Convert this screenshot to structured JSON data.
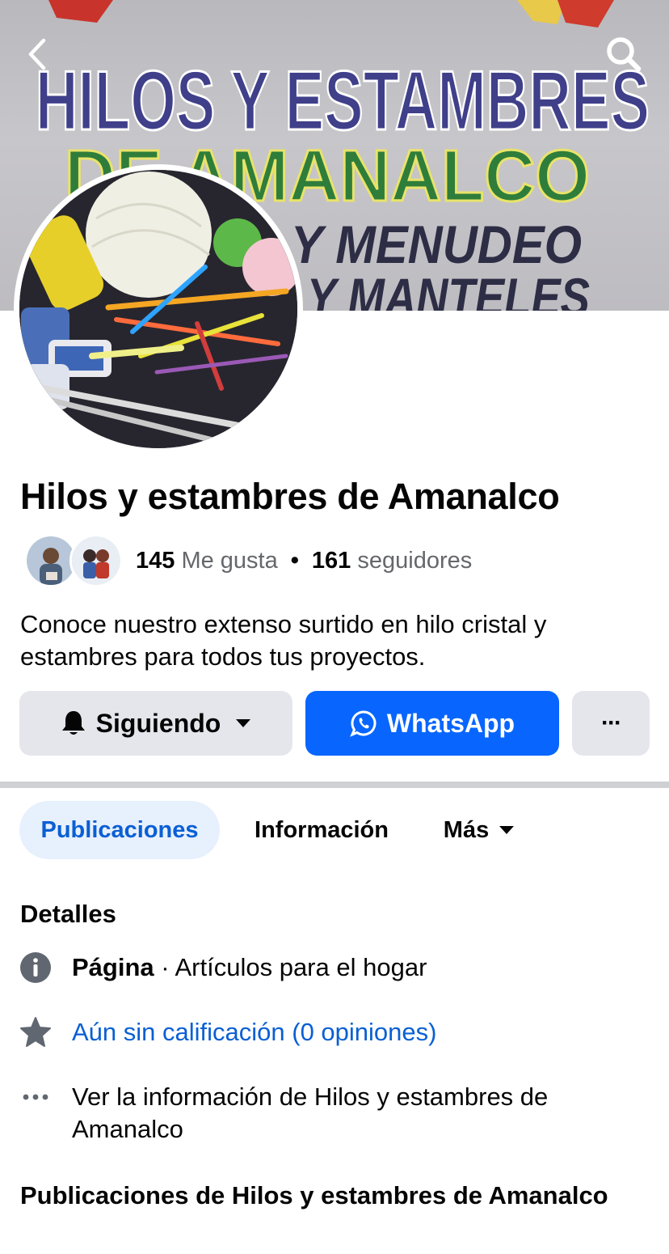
{
  "cover": {
    "sign_line1": "HILOS Y ESTAMBRES",
    "sign_line2": "DE AMANALCO",
    "sign_line3": "Y MENUDEO",
    "sign_line4": "Y MANTELES"
  },
  "nav": {
    "back_icon": "chevron-left-icon",
    "search_icon": "search-icon"
  },
  "page": {
    "title": "Hilos y estambres de Amanalco",
    "likes_count": "145",
    "likes_label": "Me gusta",
    "separator": "•",
    "followers_count": "161",
    "followers_label": "seguidores",
    "bio": "Conoce nuestro extenso surtido en hilo cristal y estambres para todos tus proyectos."
  },
  "actions": {
    "following_label": "Siguiendo",
    "whatsapp_label": "WhatsApp",
    "more_label": "···"
  },
  "tabs": [
    {
      "label": "Publicaciones",
      "active": true
    },
    {
      "label": "Información",
      "active": false
    },
    {
      "label": "Más",
      "active": false
    }
  ],
  "details": {
    "title": "Detalles",
    "category_prefix": "Página",
    "category_value": " · Artículos para el hogar",
    "rating": "Aún sin calificación (0 opiniones)",
    "see_info": "Ver la información de Hilos y estambres de Amanalco"
  },
  "posts_section": {
    "title": "Publicaciones de Hilos y estambres de Amanalco"
  },
  "colors": {
    "accent": "#0866ff",
    "link": "#0a5fd4",
    "button_gray": "#e4e6eb",
    "active_tab_bg": "#e7f0fd"
  }
}
